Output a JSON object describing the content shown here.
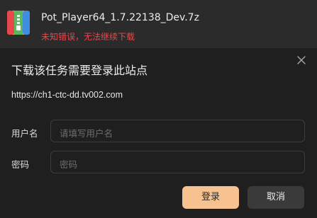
{
  "download": {
    "file_icon": "archive-file-icon",
    "file_name": "Pot_Player64_1.7.22138_Dev.7z",
    "error_message": "未知错误，无法继续下载"
  },
  "dialog": {
    "title": "下载该任务需要登录此站点",
    "close_icon": "close-icon",
    "site_url": "https://ch1-ctc-dd.tv002.com",
    "username": {
      "label": "用户名",
      "placeholder": "请填写用户名",
      "value": ""
    },
    "password": {
      "label": "密码",
      "placeholder": "密码",
      "value": ""
    },
    "login_label": "登录",
    "cancel_label": "取消"
  },
  "colors": {
    "accent": "#f7c290",
    "error": "#e8474b",
    "background": "#1f1f1f",
    "header_background": "#2b2b2b"
  }
}
